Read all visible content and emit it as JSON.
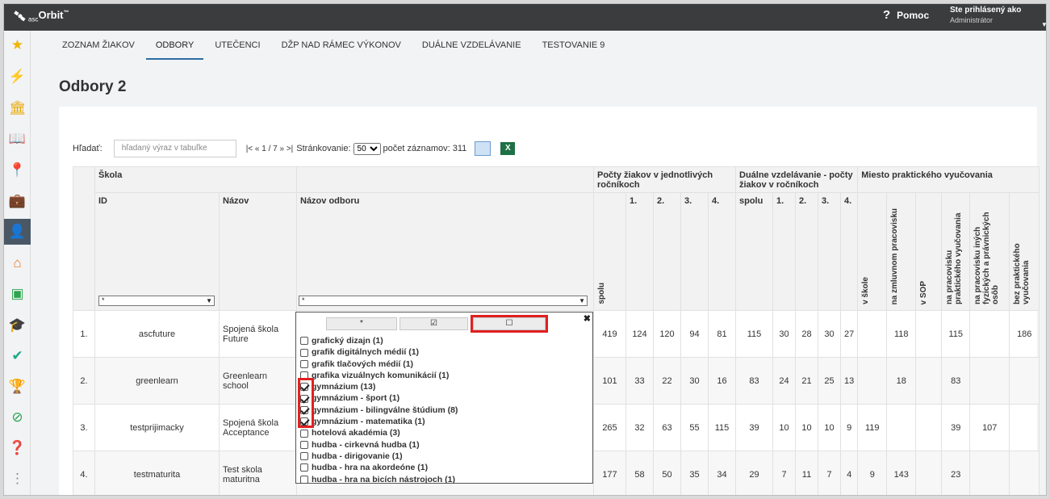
{
  "topbar": {
    "logo_asc": "asc",
    "logo_main": "Orbit",
    "logo_tm": "™",
    "help_label": "Pomoc",
    "user_line1": "Ste prihlásený ako",
    "user_line2": "Administrátor"
  },
  "sidebar": {
    "icons": [
      "star-icon",
      "magic-wand-icon",
      "institution-icon",
      "book-icon",
      "map-pin-icon",
      "briefcase-icon",
      "student-icon",
      "school-add-icon",
      "id-badge-icon",
      "graduation-cap-icon",
      "check-badge-icon",
      "trophy-icon",
      "compass-icon",
      "question-doc-icon",
      "more-icon"
    ],
    "active_index": 6
  },
  "tabs": [
    "ZOZNAM ŽIAKOV",
    "ODBORY",
    "UTEČENCI",
    "DŽP NAD RÁMEC VÝKONOV",
    "DUÁLNE VZDELÁVANIE",
    "TESTOVANIE 9"
  ],
  "active_tab": "ODBORY",
  "page_title": "Odbory 2",
  "search": {
    "label": "Hľadať:",
    "placeholder": "hľadaný výraz v tabuľke",
    "pager": "|< « 1 / 7 » >|",
    "paging_label": "Stránkovanie:",
    "paging_value": "50",
    "count_label": "počet záznamov: 311"
  },
  "table": {
    "group_headers": {
      "skola": "Škola",
      "pocty": "Počty žiakov v jednotlivých ročníkoch",
      "dualne": "Duálne vzdelávanie - počty žiakov v ročníkoch",
      "miesto": "Miesto praktického vyučovania"
    },
    "headers": {
      "id": "ID",
      "nazov": "Názov",
      "nazov_odboru": "Názov odboru",
      "spolu": "spolu",
      "r1": "1.",
      "r2": "2.",
      "r3": "3.",
      "r4": "4.",
      "d_spolu": "spolu",
      "d1": "1.",
      "d2": "2.",
      "d3": "3.",
      "d4": "4.",
      "m1": "v škole",
      "m2": "na zmluvnom pracovisku",
      "m3": "v SOP",
      "m4": "na pracovisku praktického vyučovania",
      "m5": "na pracovisku iných fyzických a právnických osôb",
      "m6": "bez praktického vyučovania"
    },
    "filter_value": "*",
    "rows": [
      {
        "n": "1.",
        "id": "ascfuture",
        "name": "Spojená škola Future",
        "spolu": "419",
        "r1": "124",
        "r2": "120",
        "r3": "94",
        "r4": "81",
        "ds": "115",
        "d1": "30",
        "d2": "28",
        "d3": "30",
        "d4": "27",
        "m1": "",
        "m2": "118",
        "m3": "",
        "m4": "115",
        "m5": "",
        "m6": "186"
      },
      {
        "n": "2.",
        "id": "greenlearn",
        "name": "Greenlearn school",
        "spolu": "101",
        "r1": "33",
        "r2": "22",
        "r3": "30",
        "r4": "16",
        "ds": "83",
        "d1": "24",
        "d2": "21",
        "d3": "25",
        "d4": "13",
        "m1": "",
        "m2": "18",
        "m3": "",
        "m4": "83",
        "m5": "",
        "m6": ""
      },
      {
        "n": "3.",
        "id": "testprijimacky",
        "name": "Spojená škola Acceptance",
        "spolu": "265",
        "r1": "32",
        "r2": "63",
        "r3": "55",
        "r4": "115",
        "ds": "39",
        "d1": "10",
        "d2": "10",
        "d3": "10",
        "d4": "9",
        "m1": "119",
        "m2": "",
        "m3": "",
        "m4": "39",
        "m5": "107",
        "m6": ""
      },
      {
        "n": "4.",
        "id": "testmaturita",
        "name": "Test skola maturitna",
        "spolu": "177",
        "r1": "58",
        "r2": "50",
        "r3": "35",
        "r4": "34",
        "ds": "29",
        "d1": "7",
        "d2": "11",
        "d3": "7",
        "d4": "4",
        "m1": "9",
        "m2": "143",
        "m3": "",
        "m4": "23",
        "m5": "",
        "m6": ""
      }
    ]
  },
  "dropdown": {
    "btn_all": "*",
    "options": [
      {
        "label": "grafický dizajn (1)",
        "checked": false
      },
      {
        "label": "grafik digitálnych médií (1)",
        "checked": false
      },
      {
        "label": "grafik tlačových médií (1)",
        "checked": false
      },
      {
        "label": "grafika vizuálnych komunikácií (1)",
        "checked": false
      },
      {
        "label": "gymnázium (13)",
        "checked": true
      },
      {
        "label": "gymnázium - šport (1)",
        "checked": true
      },
      {
        "label": "gymnázium - bilingválne štúdium (8)",
        "checked": true
      },
      {
        "label": "gymnázium - matematika (1)",
        "checked": true
      },
      {
        "label": "hotelová akadémia (3)",
        "checked": false
      },
      {
        "label": "hudba - cirkevná hudba (1)",
        "checked": false
      },
      {
        "label": "hudba - dirigovanie (1)",
        "checked": false
      },
      {
        "label": "hudba - hra na akordeóne (1)",
        "checked": false
      },
      {
        "label": "hudba - hra na bicích nástrojoch (1)",
        "checked": false
      }
    ]
  }
}
